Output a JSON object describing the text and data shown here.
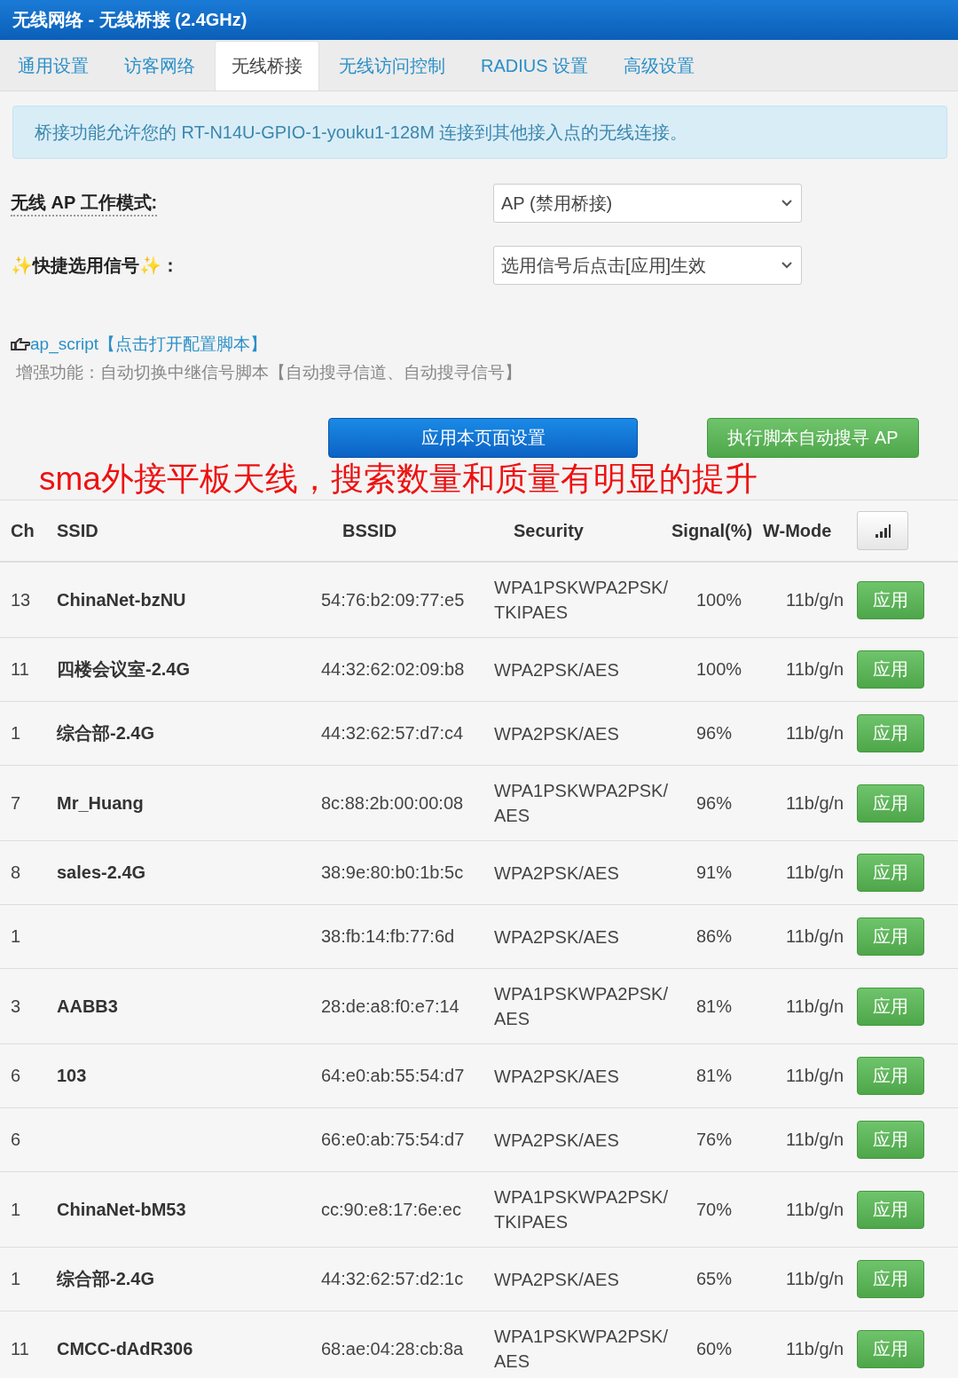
{
  "window": {
    "title": "无线网络 - 无线桥接 (2.4GHz)"
  },
  "tabs": [
    {
      "label": "通用设置",
      "selected": false
    },
    {
      "label": "访客网络",
      "selected": false
    },
    {
      "label": "无线桥接",
      "selected": true
    },
    {
      "label": "无线访问控制",
      "selected": false
    },
    {
      "label": "RADIUS 设置",
      "selected": false
    },
    {
      "label": "高级设置",
      "selected": false
    }
  ],
  "info": "桥接功能允许您的 RT-N14U-GPIO-1-youku1-128M 连接到其他接入点的无线连接。",
  "form": [
    {
      "label": "无线 AP 工作模式:",
      "value": "AP (禁用桥接)"
    },
    {
      "label": "✨快捷选用信号✨：",
      "value": "选用信号后点击[应用]生效"
    }
  ],
  "script": {
    "link": "ap_script【点击打开配置脚本】",
    "description": "增强功能：自动切换中继信号脚本【自动搜寻信道、自动搜寻信号】"
  },
  "actions": [
    {
      "label": "应用本页面设置",
      "kind": "primary"
    },
    {
      "label": "执行脚本自动搜寻 AP",
      "kind": "success"
    }
  ],
  "annotation": "sma外接平板天线，搜索数量和质量有明显的提升",
  "table": {
    "columns": [
      "Ch",
      "SSID",
      "BSSID",
      "Security",
      "Signal(%)",
      "W-Mode"
    ],
    "rows": [
      {
        "ch": "13",
        "ssid": "ChinaNet-bzNU",
        "bssid": "54:76:b2:09:77:e5",
        "security": "WPA1PSKWPA2PSK/ TKIPAES",
        "signal": "100%",
        "mode": "11b/g/n",
        "action": "应用"
      },
      {
        "ch": "11",
        "ssid": "四楼会议室-2.4G",
        "bssid": "44:32:62:02:09:b8",
        "security": "WPA2PSK/AES",
        "signal": "100%",
        "mode": "11b/g/n",
        "action": "应用"
      },
      {
        "ch": "1",
        "ssid": "综合部-2.4G",
        "bssid": "44:32:62:57:d7:c4",
        "security": "WPA2PSK/AES",
        "signal": "96%",
        "mode": "11b/g/n",
        "action": "应用"
      },
      {
        "ch": "7",
        "ssid": "Mr_Huang",
        "bssid": "8c:88:2b:00:00:08",
        "security": "WPA1PSKWPA2PSK/ AES",
        "signal": "96%",
        "mode": "11b/g/n",
        "action": "应用"
      },
      {
        "ch": "8",
        "ssid": "sales-2.4G",
        "bssid": "38:9e:80:b0:1b:5c",
        "security": "WPA2PSK/AES",
        "signal": "91%",
        "mode": "11b/g/n",
        "action": "应用"
      },
      {
        "ch": "1",
        "bssid": "38:fb:14:fb:77:6d",
        "security": "WPA2PSK/AES",
        "signal": "86%",
        "mode": "11b/g/n",
        "action": "应用"
      },
      {
        "ch": "3",
        "ssid": "AABB3",
        "bssid": "28:de:a8:f0:e7:14",
        "security": "WPA1PSKWPA2PSK/ AES",
        "signal": "81%",
        "mode": "11b/g/n",
        "action": "应用"
      },
      {
        "ch": "6",
        "ssid": "103",
        "bssid": "64:e0:ab:55:54:d7",
        "security": "WPA2PSK/AES",
        "signal": "81%",
        "mode": "11b/g/n",
        "action": "应用"
      },
      {
        "ch": "6",
        "bssid": "66:e0:ab:75:54:d7",
        "security": "WPA2PSK/AES",
        "signal": "76%",
        "mode": "11b/g/n",
        "action": "应用"
      },
      {
        "ch": "1",
        "ssid": "ChinaNet-bM53",
        "bssid": "cc:90:e8:17:6e:ec",
        "security": "WPA1PSKWPA2PSK/ TKIPAES",
        "signal": "70%",
        "mode": "11b/g/n",
        "action": "应用"
      },
      {
        "ch": "1",
        "ssid": "综合部-2.4G",
        "bssid": "44:32:62:57:d2:1c",
        "security": "WPA2PSK/AES",
        "signal": "65%",
        "mode": "11b/g/n",
        "action": "应用"
      },
      {
        "ch": "11",
        "ssid": "CMCC-dAdR306",
        "bssid": "68:ae:04:28:cb:8a",
        "security": "WPA1PSKWPA2PSK/ AES",
        "signal": "60%",
        "mode": "11b/g/n",
        "action": "应用"
      }
    ]
  }
}
